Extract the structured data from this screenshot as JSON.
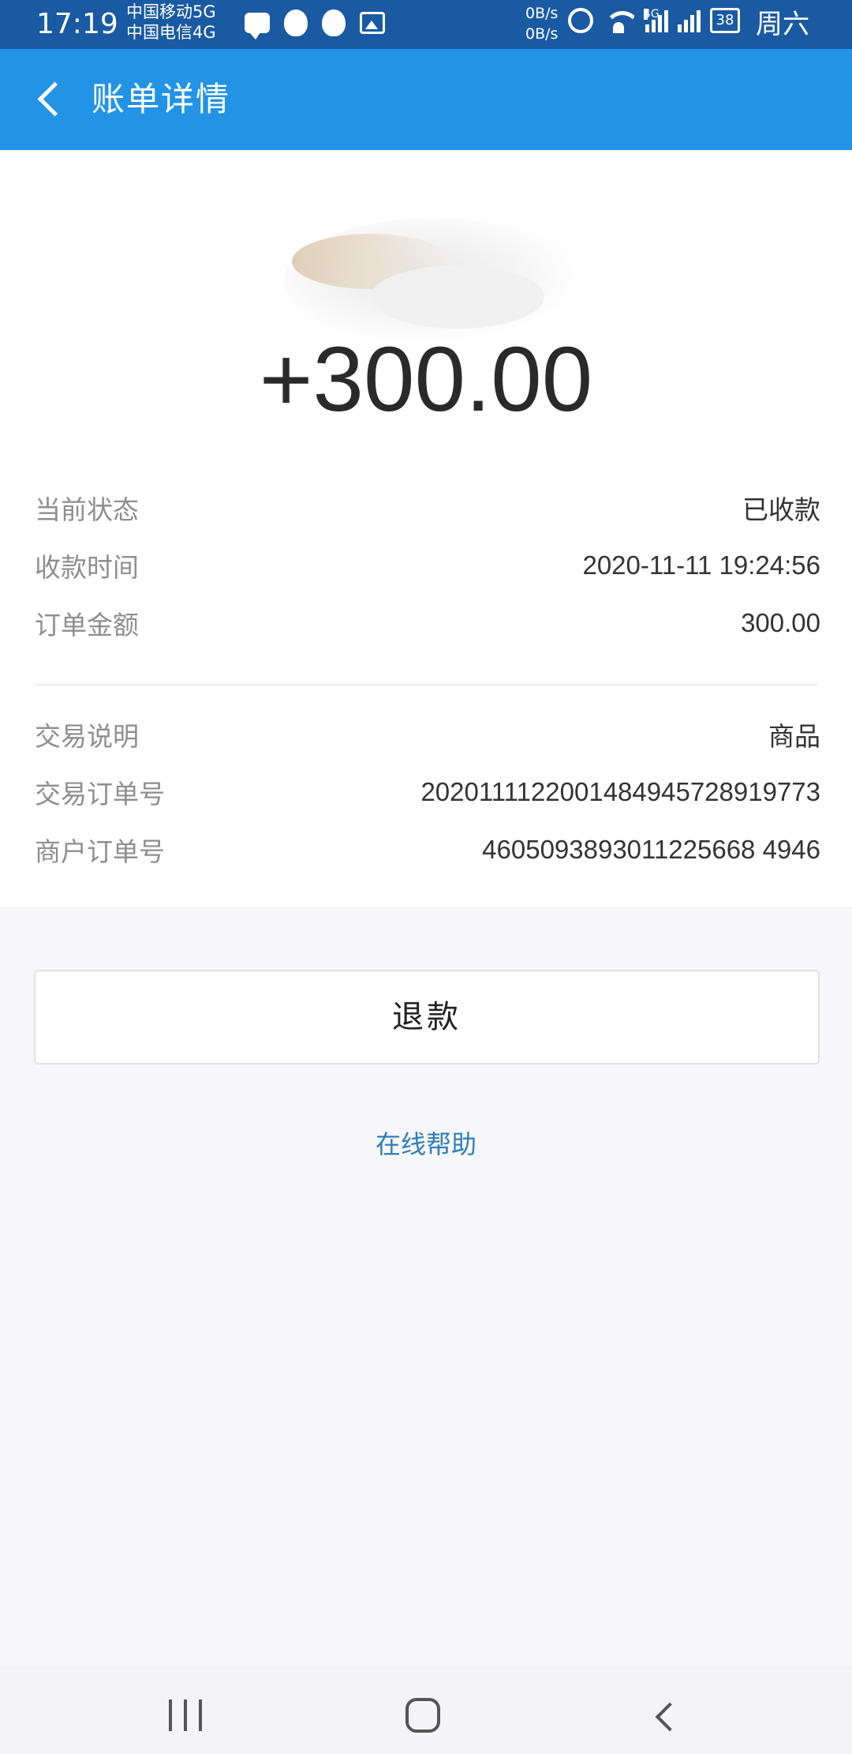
{
  "status_bar": {
    "time": "17:19",
    "carrier1": "中国移动5G",
    "carrier2": "中国电信4G",
    "net_up": "0B/s",
    "net_down": "0B/s",
    "network_tag": "4G",
    "battery": "38",
    "weekday": "周六",
    "icons": [
      "message-icon",
      "qq-icon",
      "qq-icon",
      "image-icon",
      "alarm-icon",
      "wifi-icon",
      "signal-icon",
      "signal-icon",
      "battery-icon"
    ]
  },
  "header": {
    "title": "账单详情",
    "back_icon": "chevron-left-icon",
    "color": "#2393e6"
  },
  "summary": {
    "amount": "+300.00"
  },
  "details": [
    {
      "label": "当前状态",
      "value": "已收款"
    },
    {
      "label": "收款时间",
      "value": "2020-11-11 19:24:56"
    },
    {
      "label": "订单金额",
      "value": "300.00"
    }
  ],
  "transaction": [
    {
      "label": "交易说明",
      "value": "商品"
    },
    {
      "label": "交易订单号",
      "value": "2020111122001484945728919773"
    },
    {
      "label": "商户订单号",
      "value": "4605093893011225668 4946"
    }
  ],
  "actions": {
    "refund_label": "退款",
    "help_label": "在线帮助",
    "help_color": "#2d7fb8"
  },
  "nav": {
    "recents_icon": "recents-icon",
    "home_icon": "home-icon",
    "back_icon": "back-icon"
  }
}
